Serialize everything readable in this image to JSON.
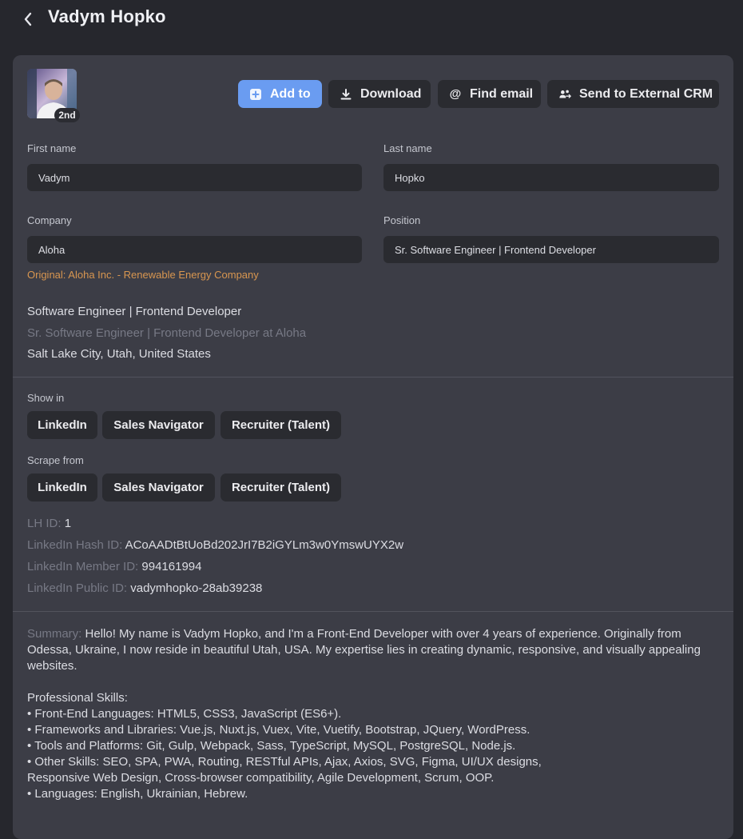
{
  "header": {
    "title": "Vadym Hopko"
  },
  "profile": {
    "connection_badge": "2nd"
  },
  "actions": {
    "add_to": "Add to",
    "download": "Download",
    "find_email": "Find email",
    "send_crm": "Send to External CRM",
    "accent_color": "#6a9cf1"
  },
  "form": {
    "first_name_label": "First name",
    "first_name_value": "Vadym",
    "last_name_label": "Last name",
    "last_name_value": "Hopko",
    "company_label": "Company",
    "company_value": "Aloha",
    "position_label": "Position",
    "position_value": "Sr. Software Engineer | Frontend Developer",
    "original_company": "Original: Aloha Inc. - Renewable Energy Company"
  },
  "info": {
    "headline": "Software Engineer | Frontend Developer",
    "current_position": "Sr. Software Engineer | Frontend Developer at Aloha",
    "location": "Salt Lake City, Utah, United States"
  },
  "show_in": {
    "label": "Show in",
    "chips": [
      "LinkedIn",
      "Sales Navigator",
      "Recruiter (Talent)"
    ]
  },
  "scrape_from": {
    "label": "Scrape from",
    "chips": [
      "LinkedIn",
      "Sales Navigator",
      "Recruiter (Talent)"
    ]
  },
  "ids": {
    "lh_id_label": "LH ID:",
    "lh_id_value": "1",
    "hash_id_label": "LinkedIn Hash ID:",
    "hash_id_value": "ACoAADtBtUoBd202JrI7B2iGYLm3w0YmswUYX2w",
    "member_id_label": "LinkedIn Member ID:",
    "member_id_value": "994161994",
    "public_id_label": "LinkedIn Public ID:",
    "public_id_value": "vadymhopko-28ab39238"
  },
  "summary": {
    "label": "Summary:",
    "intro": "Hello! My name is Vadym Hopko, and I'm a Front-End Developer with over 4 years of experience. Originally from Odessa, Ukraine, I now reside in beautiful Utah, USA. My expertise lies in creating dynamic, responsive, and visually appealing websites.",
    "skills_heading": "Professional Skills:",
    "skills": [
      "• Front-End Languages: HTML5, CSS3, JavaScript (ES6+).",
      "• Frameworks and Libraries: Vue.js, Nuxt.js, Vuex, Vite, Vuetify, Bootstrap, JQuery, WordPress.",
      "• Tools and Platforms: Git, Gulp, Webpack, Sass, TypeScript, MySQL, PostgreSQL, Node.js.",
      "• Other Skills: SEO, SPA, PWA, Routing, RESTful APIs, Ajax, Axios, SVG, Figma, UI/UX designs,",
      "Responsive Web Design, Cross-browser compatibility, Agile Development, Scrum, OOP.",
      "• Languages: English, Ukrainian, Hebrew."
    ]
  }
}
